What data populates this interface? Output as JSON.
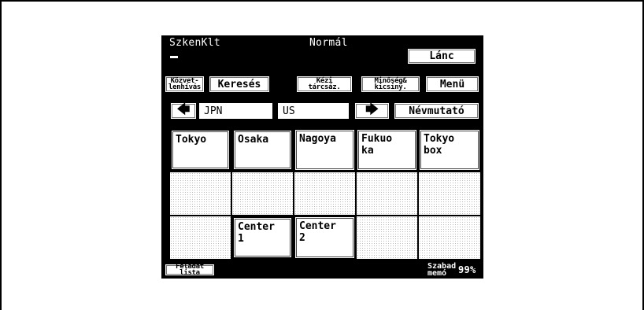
{
  "header": {
    "mode": "SzkenKlt",
    "quality": "Normál",
    "chain_button": "Lánc"
  },
  "tabs": [
    {
      "label": "Közvet-\nlenhívás"
    },
    {
      "label": "Keresés"
    },
    {
      "label": "Kézi\ntárcsáz."
    },
    {
      "label": "Minőség&\nkicsiny."
    },
    {
      "label": "Menü"
    }
  ],
  "nav": {
    "field1": "JPN",
    "field2": "US",
    "index_button": "Névmutató"
  },
  "destinations": [
    [
      "Tokyo",
      "Osaka",
      "Nagoya",
      " Fukuo\nka",
      "Tokyo\nbox"
    ],
    [
      "",
      "",
      "",
      "",
      ""
    ],
    [
      "",
      "Center\n 1",
      "Center\n 2",
      "",
      ""
    ]
  ],
  "footer": {
    "job_list_button": "Feladat\nlista",
    "free_memory_label": "Szabad\nmemó",
    "free_memory_value": "99%"
  }
}
